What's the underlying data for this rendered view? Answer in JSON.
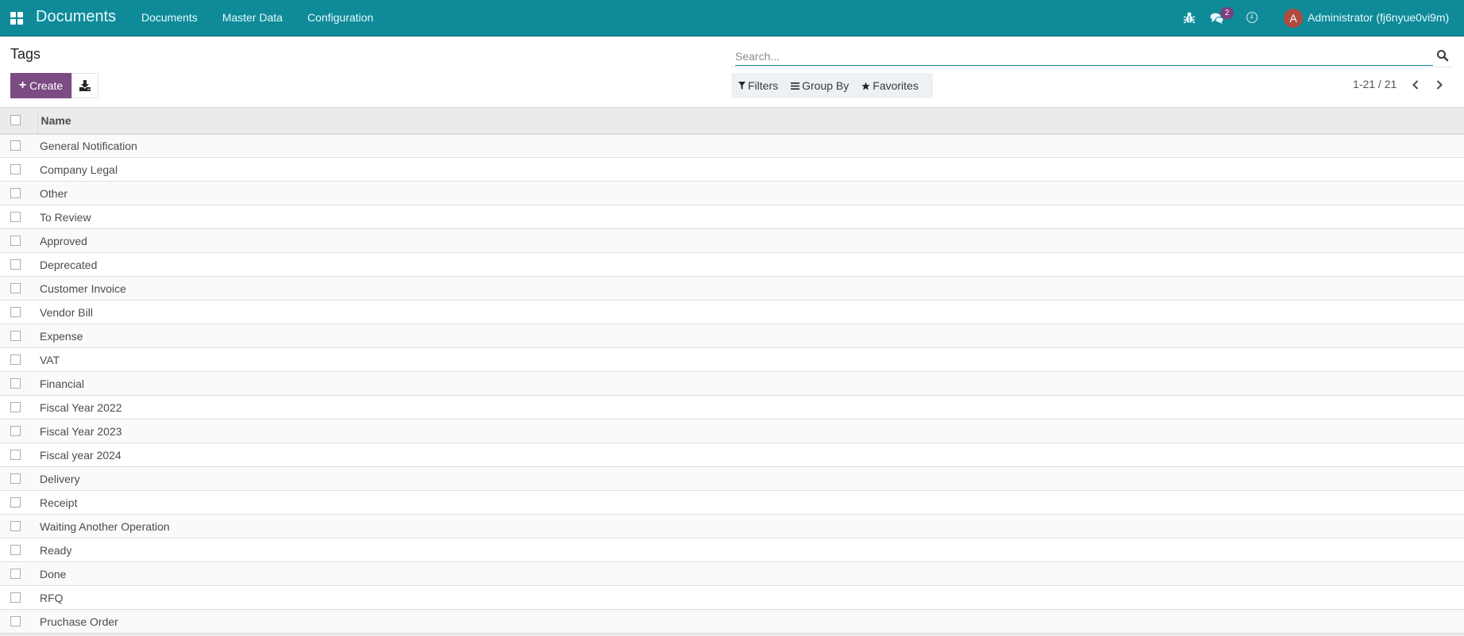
{
  "navbar": {
    "app_name": "Documents",
    "menu": [
      {
        "label": "Documents"
      },
      {
        "label": "Master Data"
      },
      {
        "label": "Configuration"
      }
    ],
    "icons": {
      "apps": "apps-grid-icon",
      "debug": "bug-icon",
      "messages": "chat-icon",
      "activities": "clock-icon"
    },
    "messages_badge": "2",
    "user": {
      "avatar_initial": "A",
      "avatar_color": "#b04b3e",
      "name": "Administrator (fj6nyue0vi9m)"
    },
    "brand_color": "#0f8a98"
  },
  "control_panel": {
    "title": "Tags",
    "create_label": "Create",
    "create_color": "#7c4b83",
    "search": {
      "placeholder": "Search...",
      "value": ""
    },
    "filters": [
      {
        "label": "Filters",
        "icon": "filter-icon"
      },
      {
        "label": "Group By",
        "icon": "bars-icon"
      },
      {
        "label": "Favorites",
        "icon": "star-icon"
      }
    ],
    "pager": {
      "value": "1-21 / 21"
    }
  },
  "table": {
    "columns": [
      {
        "label": "Name"
      }
    ],
    "rows": [
      {
        "name": "General Notification"
      },
      {
        "name": "Company Legal"
      },
      {
        "name": "Other"
      },
      {
        "name": "To Review"
      },
      {
        "name": "Approved"
      },
      {
        "name": "Deprecated"
      },
      {
        "name": "Customer Invoice"
      },
      {
        "name": "Vendor Bill"
      },
      {
        "name": "Expense"
      },
      {
        "name": "VAT"
      },
      {
        "name": "Financial"
      },
      {
        "name": "Fiscal Year 2022"
      },
      {
        "name": "Fiscal Year 2023"
      },
      {
        "name": "Fiscal year 2024"
      },
      {
        "name": "Delivery"
      },
      {
        "name": "Receipt"
      },
      {
        "name": "Waiting Another Operation"
      },
      {
        "name": "Ready"
      },
      {
        "name": "Done"
      },
      {
        "name": "RFQ"
      },
      {
        "name": "Pruchase Order"
      }
    ]
  }
}
